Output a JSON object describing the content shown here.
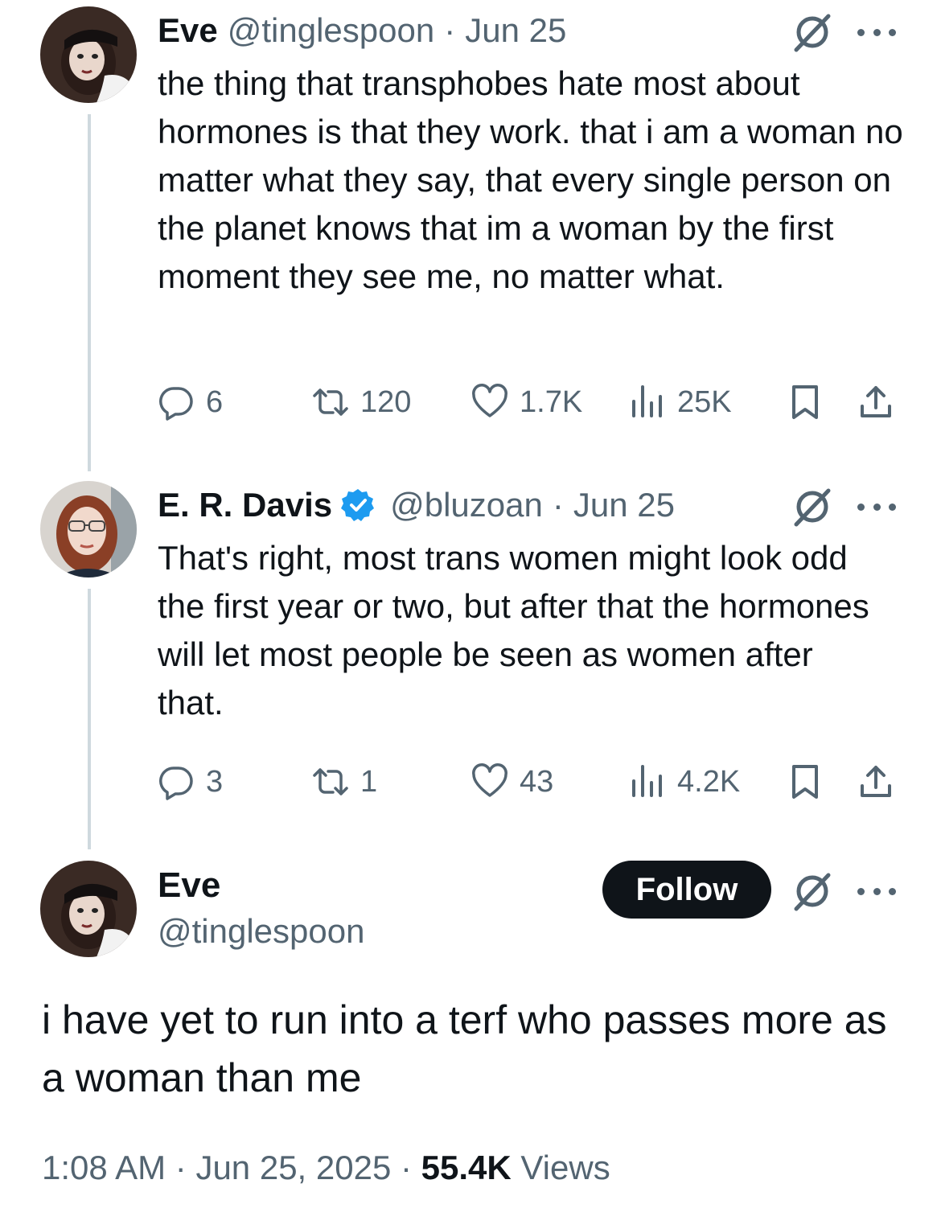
{
  "tweets": [
    {
      "name": "Eve",
      "handle": "@tinglespoon",
      "separator": "·",
      "date": "Jun 25",
      "text": "the thing that transphobes hate most about hormones is that they work. that i am a woman no matter what they say, that every single person on the planet knows that im a woman by the first moment they see me, no matter what.",
      "replies": "6",
      "retweets": "120",
      "likes": "1.7K",
      "views": "25K"
    },
    {
      "name": "E. R. Davis",
      "handle": "@bluzoan",
      "separator": "·",
      "date": "Jun 25",
      "verified": true,
      "text": "That's right, most trans women might look odd the first year or two, but after that the hormones will let most people be seen as women after that.",
      "replies": "3",
      "retweets": "1",
      "likes": "43",
      "views": "4.2K"
    }
  ],
  "main": {
    "name": "Eve",
    "handle": "@tinglespoon",
    "follow_label": "Follow",
    "text": "i have yet to run into a terf who passes more as a woman than me",
    "time": "1:08 AM",
    "separator": "·",
    "date": "Jun 25, 2025",
    "views_count": "55.4K",
    "views_label": "Views"
  },
  "icons": {
    "reply": "reply-icon",
    "retweet": "retweet-icon",
    "like": "like-icon",
    "views": "views-icon",
    "bookmark": "bookmark-icon",
    "share": "share-icon",
    "grok": "grok-icon",
    "more": "more-icon",
    "verified": "verified-badge-icon"
  },
  "colors": {
    "text": "#0f1419",
    "secondary": "#536471",
    "verified": "#1d9bf0",
    "thread_line": "#cfd9de",
    "follow_bg": "#0f1419"
  }
}
